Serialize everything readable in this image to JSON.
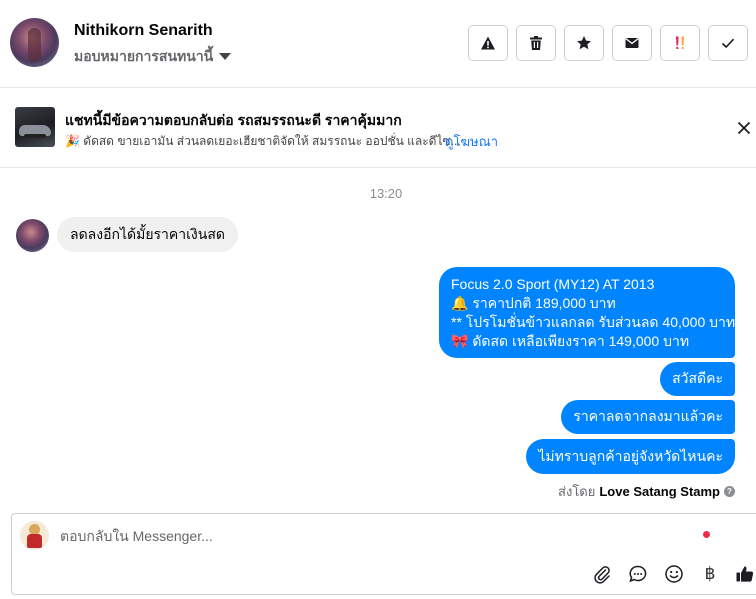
{
  "header": {
    "contact_name": "Nithikorn Senarith",
    "assign_label": "มอบหมายการสนทนานี้",
    "actions": [
      {
        "name": "report-spam",
        "icon": "alert-triangle-icon"
      },
      {
        "name": "delete",
        "icon": "trash-icon"
      },
      {
        "name": "star",
        "icon": "star-icon"
      },
      {
        "name": "mark-unread",
        "icon": "envelope-icon"
      },
      {
        "name": "follow-up",
        "icon": "double-exclamation-icon"
      },
      {
        "name": "mark-done",
        "icon": "check-icon"
      }
    ]
  },
  "ad_banner": {
    "title": "แชทนี้มีข้อความตอบกลับต่อ รถสมรรถนะดี ราคาคุ้มมาก",
    "subtitle": "🎉 ดัดสด ขายเอามัน ส่วนลดเยอะเฮียชาติจัดให้ สมรรถนะ ออปชั่น และดีไซ...",
    "link_label": "ดูโฆษณา"
  },
  "conversation": {
    "timestamp": "13:20",
    "incoming": [
      {
        "text": "ลดลงอีกได้มั้ยราคาเงินสด"
      }
    ],
    "outgoing_long": {
      "line1": "Focus 2.0 Sport (MY12) AT 2013",
      "line2": "🔔 ราคาปกติ 189,000 บาท",
      "line3": "** โปรโมชั่นข้าวแลกลด รับส่วนลด 40,000 บาท",
      "line4": "🎀 ดัดสด เหลือเพียงราคา 149,000 บาท"
    },
    "outgoing": [
      {
        "text": "สวัสดีคะ"
      },
      {
        "text": "ราคาลดจากลงมาแล้วคะ"
      },
      {
        "text": "ไม่ทราบลูกค้าอยู่จังหวัดไหนคะ"
      }
    ],
    "sent_by_prefix": "ส่งโดย",
    "sent_by_name": "Love Satang Stamp",
    "info_icon": "?"
  },
  "composer": {
    "placeholder": "ตอบกลับใน Messenger...",
    "value": "",
    "baht_symbol": "฿",
    "tools": [
      "paperclip-icon",
      "chat-bubble-icon",
      "smiley-icon",
      "baht-icon",
      "thumbs-up-icon"
    ]
  },
  "colors": {
    "accent": "#0084ff",
    "link": "#1877f2",
    "incoming_bubble": "#f0f0f0",
    "notification_dot": "#f02849"
  }
}
